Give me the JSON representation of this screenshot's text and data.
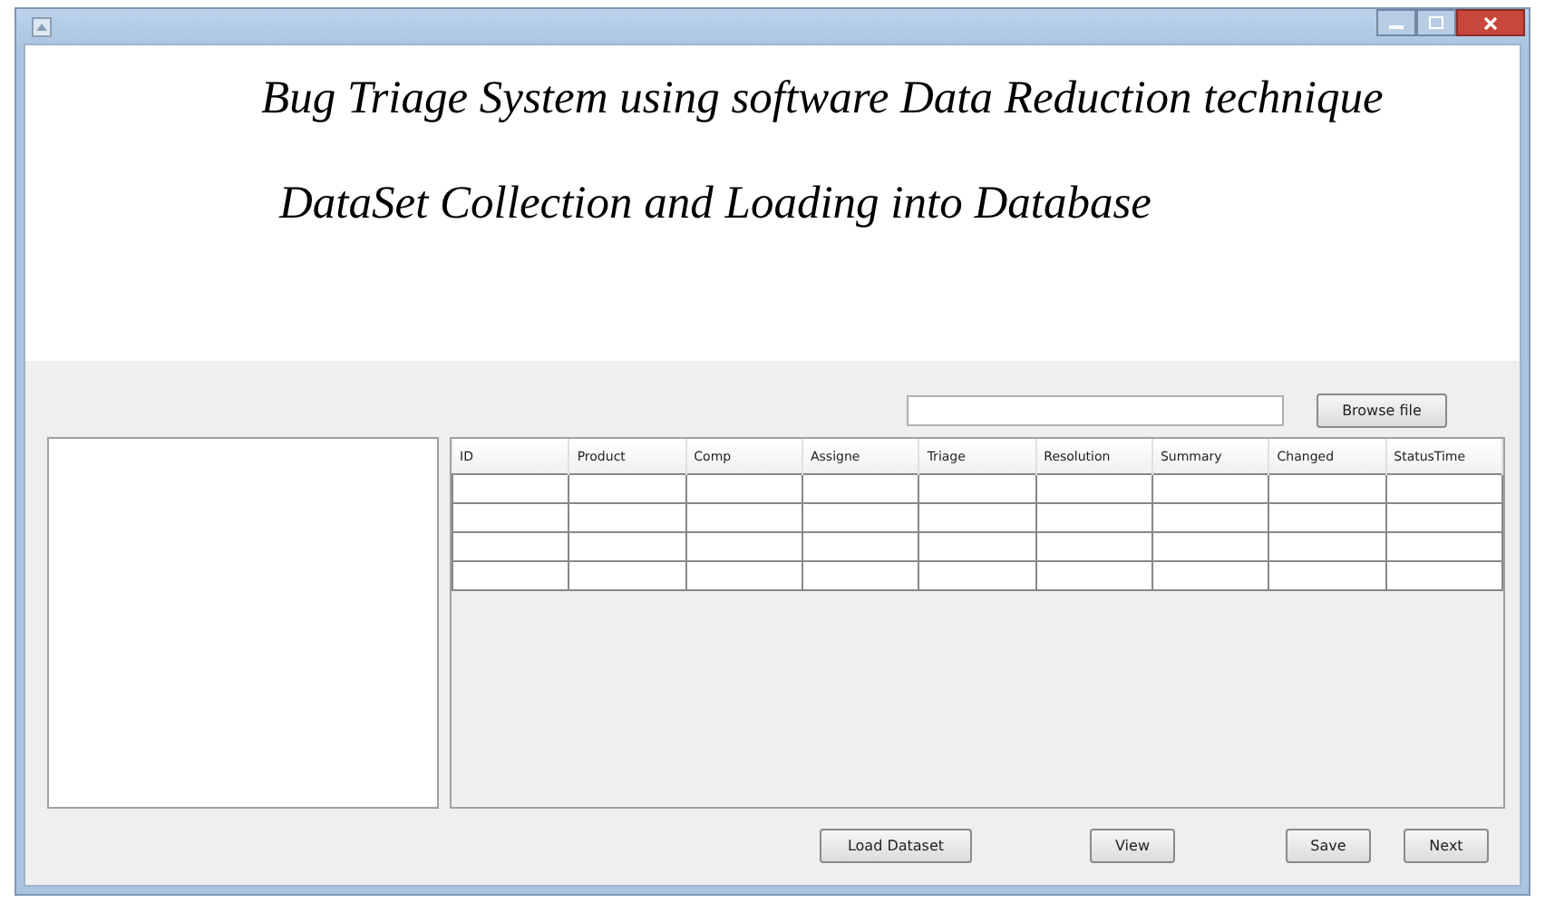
{
  "header": {
    "title": "Bug Triage System using software Data Reduction technique",
    "subtitle": "DataSet Collection and Loading into Database"
  },
  "file_field": {
    "button": "Browse file"
  },
  "table": {
    "columns": [
      "ID",
      "Product",
      "Comp",
      "Assigne",
      "Triage",
      "Resolution",
      "Summary",
      "Changed",
      "StatusTime"
    ]
  },
  "buttons": [
    "Load Dataset",
    "View",
    "Save",
    "Next"
  ]
}
